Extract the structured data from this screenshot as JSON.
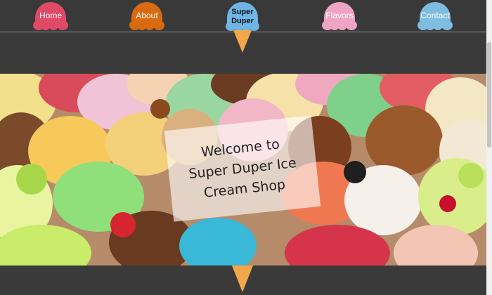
{
  "nav": {
    "items": [
      {
        "label": "Home",
        "color": "#e04a66"
      },
      {
        "label": "About",
        "color": "#d86a10"
      },
      {
        "label": "Flavors",
        "color": "#f0a4c4"
      },
      {
        "label": "Contact",
        "color": "#7fbde0"
      }
    ]
  },
  "logo": {
    "line1": "Super",
    "line2": "Duper",
    "scoop_color": "#6fb6e6",
    "cone_color": "#f2a84a"
  },
  "hero": {
    "welcome_line1": "Welcome to",
    "welcome_line2": "Super Duper Ice",
    "welcome_line3": "Cream Shop"
  },
  "colors": {
    "background": "#3a3a3a",
    "cone": "#f2a84a"
  }
}
